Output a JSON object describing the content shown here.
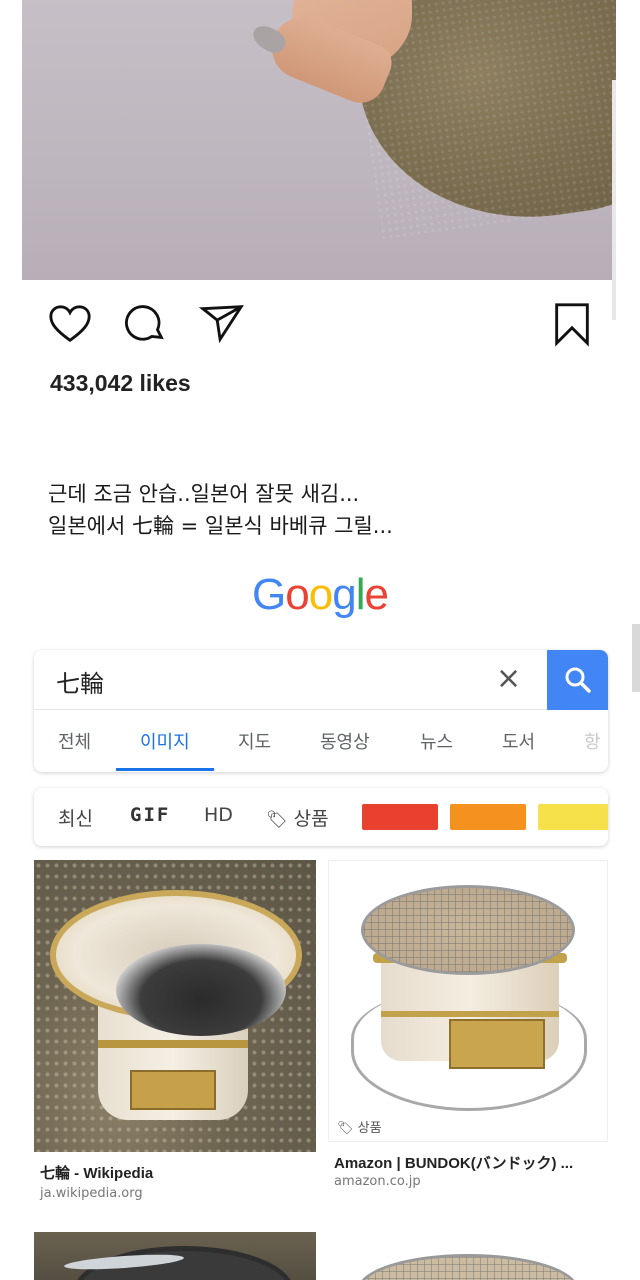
{
  "post": {
    "likes": "433,042 likes",
    "caption_line1": "근데 조금 안습..일본어 잘못 새김...",
    "caption_line2": "일본에서 七輪 = 일본식 바베큐 그릴..."
  },
  "google": {
    "logo_letters": [
      {
        "char": "G",
        "color": "#4285f4"
      },
      {
        "char": "o",
        "color": "#ea4335"
      },
      {
        "char": "o",
        "color": "#fbbc05"
      },
      {
        "char": "g",
        "color": "#4285f4"
      },
      {
        "char": "l",
        "color": "#34a853"
      },
      {
        "char": "e",
        "color": "#ea4335"
      }
    ],
    "search": {
      "query": "七輪",
      "clear_icon": "×"
    },
    "tabs": [
      {
        "label": "전체",
        "active": false
      },
      {
        "label": "이미지",
        "active": true
      },
      {
        "label": "지도",
        "active": false
      },
      {
        "label": "동영상",
        "active": false
      },
      {
        "label": "뉴스",
        "active": false
      },
      {
        "label": "도서",
        "active": false
      },
      {
        "label": "항",
        "active": false
      }
    ],
    "filters": {
      "recent": "최신",
      "gif": "GIF",
      "hd": "HD",
      "product": "상품",
      "color_swatches": [
        "#e8412f",
        "#f5911e",
        "#f7e14a"
      ]
    },
    "results": [
      {
        "title": "七輪 - Wikipedia",
        "source": "ja.wikipedia.org"
      },
      {
        "title": "Amazon | BUNDOK(バンドック) ...",
        "source": "amazon.co.jp",
        "tag": "상품"
      }
    ]
  },
  "colors": {
    "accent_blue": "#4285f4",
    "active_tab": "#1a73e8"
  }
}
